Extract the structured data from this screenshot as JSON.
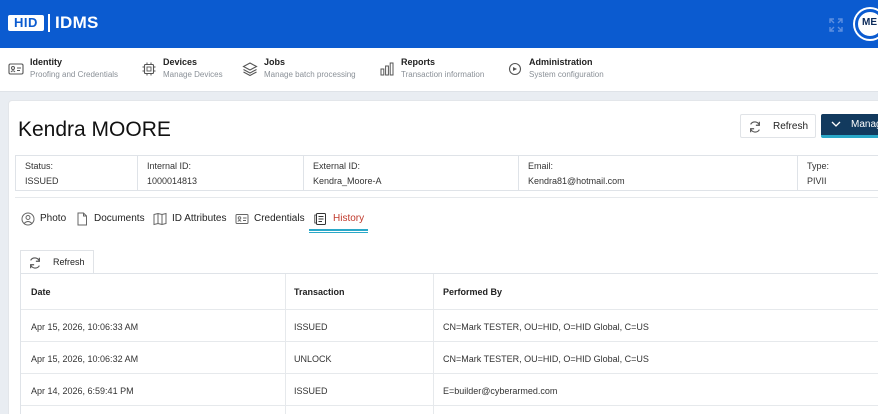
{
  "header": {
    "logo_text": "HID",
    "app_title": "IDMS",
    "user_initials": "ME"
  },
  "nav": [
    {
      "title": "Identity",
      "subtitle": "Proofing and Credentials",
      "icon": "id-card-icon"
    },
    {
      "title": "Devices",
      "subtitle": "Manage Devices",
      "icon": "chip-icon"
    },
    {
      "title": "Jobs",
      "subtitle": "Manage batch processing",
      "icon": "layers-icon"
    },
    {
      "title": "Reports",
      "subtitle": "Transaction information",
      "icon": "bar-chart-icon"
    },
    {
      "title": "Administration",
      "subtitle": "System configuration",
      "icon": "settings-icon"
    }
  ],
  "person": {
    "name": "Kendra MOORE"
  },
  "actions": {
    "refresh_label": "Refresh",
    "manage_label": "Manag"
  },
  "info": [
    {
      "label": "Status:",
      "value": "ISSUED"
    },
    {
      "label": "Internal ID:",
      "value": "1000014813"
    },
    {
      "label": "External ID:",
      "value": "Kendra_Moore-A"
    },
    {
      "label": "Email:",
      "value": "Kendra81@hotmail.com"
    },
    {
      "label": "Type:",
      "value": "PIVII"
    }
  ],
  "tabs": [
    {
      "label": "Photo",
      "icon": "user-circle-icon"
    },
    {
      "label": "Documents",
      "icon": "document-icon"
    },
    {
      "label": "ID Attributes",
      "icon": "book-icon"
    },
    {
      "label": "Credentials",
      "icon": "id-card-icon"
    },
    {
      "label": "History",
      "icon": "history-icon",
      "active": true
    }
  ],
  "history": {
    "refresh_label": "Refresh",
    "columns": [
      "Date",
      "Transaction",
      "Performed By"
    ],
    "rows": [
      [
        "Apr 15, 2026, 10:06:33 AM",
        "ISSUED",
        "CN=Mark TESTER, OU=HID, O=HID Global, C=US"
      ],
      [
        "Apr 15, 2026, 10:06:32 AM",
        "UNLOCK",
        "CN=Mark TESTER, OU=HID, O=HID Global, C=US"
      ],
      [
        "Apr 14, 2026, 6:59:41 PM",
        "ISSUED",
        "E=builder@cyberarmed.com"
      ]
    ]
  },
  "colors": {
    "brand_blue": "#0b5bd0",
    "manage_dark": "#123a5e",
    "accent_teal": "#2aa8c8",
    "active_tab_red": "#c0392b"
  }
}
